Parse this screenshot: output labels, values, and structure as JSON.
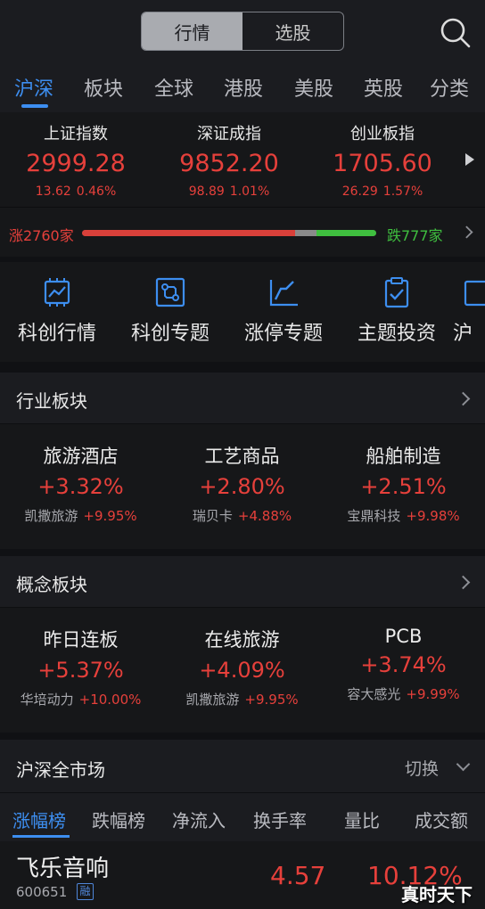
{
  "header": {
    "tabs": [
      "行情",
      "选股"
    ],
    "active_tab": "行情"
  },
  "market_tabs": [
    "沪深",
    "板块",
    "全球",
    "港股",
    "美股",
    "英股",
    "分类"
  ],
  "indices": [
    {
      "name": "上证指数",
      "price": "2999.28",
      "change": "13.62",
      "pct": "0.46%"
    },
    {
      "name": "深证成指",
      "price": "9852.20",
      "change": "98.89",
      "pct": "1.01%"
    },
    {
      "name": "创业板指",
      "price": "1705.60",
      "change": "26.29",
      "pct": "1.57%"
    }
  ],
  "breadth": {
    "rise_label": "涨2760家",
    "fall_label": "跌777家",
    "rise_count": 2760,
    "fall_count": 777
  },
  "shortcuts": [
    "科创行情",
    "科创专题",
    "涨停专题",
    "主题投资",
    "沪"
  ],
  "industry": {
    "title": "行业板块",
    "items": [
      {
        "name": "旅游酒店",
        "pct": "+3.32%",
        "leader": "凯撒旅游",
        "leader_pct": "+9.95%"
      },
      {
        "name": "工艺商品",
        "pct": "+2.80%",
        "leader": "瑞贝卡",
        "leader_pct": "+4.88%"
      },
      {
        "name": "船舶制造",
        "pct": "+2.51%",
        "leader": "宝鼎科技",
        "leader_pct": "+9.98%"
      }
    ]
  },
  "concept": {
    "title": "概念板块",
    "items": [
      {
        "name": "昨日连板",
        "pct": "+5.37%",
        "leader": "华培动力",
        "leader_pct": "+10.00%"
      },
      {
        "name": "在线旅游",
        "pct": "+4.09%",
        "leader": "凯撒旅游",
        "leader_pct": "+9.95%"
      },
      {
        "name": "PCB",
        "pct": "+3.74%",
        "leader": "容大感光",
        "leader_pct": "+9.99%"
      }
    ]
  },
  "market": {
    "title": "沪深全市场",
    "switch_label": "切换",
    "rank_tabs": [
      "涨幅榜",
      "跌幅榜",
      "净流入",
      "换手率",
      "量比",
      "成交额"
    ],
    "stock": {
      "name": "飞乐音响",
      "code": "600651",
      "tag": "融",
      "price": "4.57",
      "pct": "10.12%"
    }
  },
  "watermark": "真时天下",
  "colors": {
    "up": "#e6403b",
    "down": "#3fbf3f",
    "accent": "#3d8ef0"
  }
}
